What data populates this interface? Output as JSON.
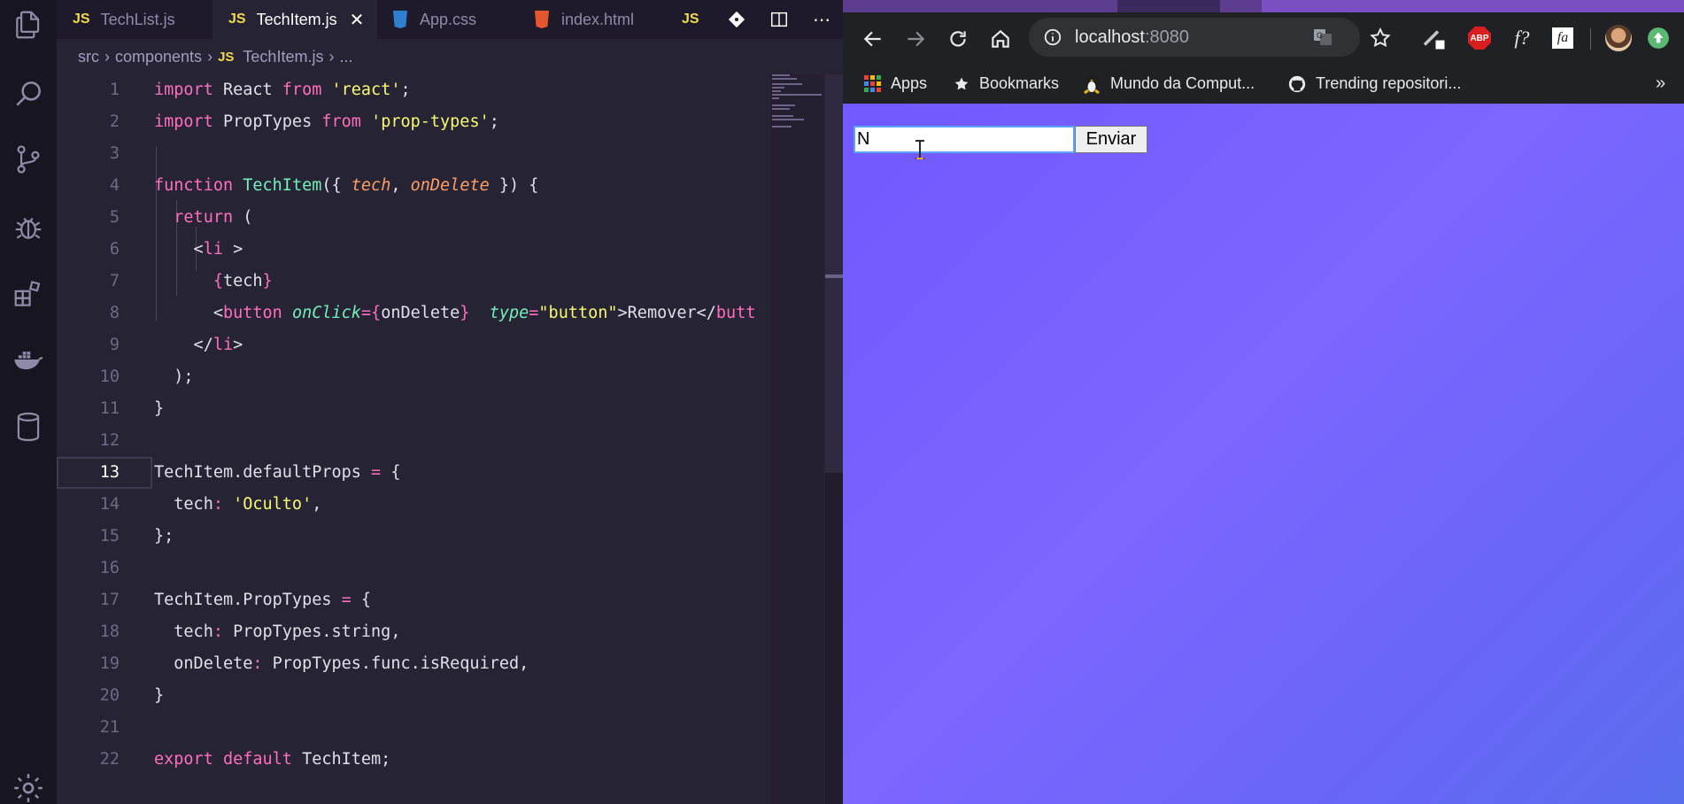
{
  "editor_tabs": [
    {
      "icon": "JS",
      "label": "TechList.js"
    },
    {
      "icon": "JS",
      "label": "TechItem.js",
      "active": true
    },
    {
      "icon": "css3-icon",
      "label": "App.css"
    },
    {
      "icon": "html5-icon",
      "label": "index.html"
    },
    {
      "icon": "JS",
      "label": ""
    }
  ],
  "breadcrumb": {
    "parts": [
      "src",
      "components"
    ],
    "file_icon": "JS",
    "file": "TechItem.js",
    "more": "..."
  },
  "code": {
    "line_numbers": [
      "1",
      "2",
      "3",
      "4",
      "5",
      "6",
      "7",
      "8",
      "9",
      "10",
      "11",
      "12",
      "13",
      "14",
      "15",
      "16",
      "17",
      "18",
      "19",
      "20",
      "21",
      "22"
    ],
    "current_line": "13"
  },
  "browser": {
    "url_host": "localhost",
    "url_port": ":8080",
    "bookmarks": [
      "Apps",
      "Bookmarks",
      "Mundo da Comput...",
      "Trending repositori..."
    ],
    "overflow": "»",
    "extension_labels": {
      "abp": "ABP",
      "fx": "f?",
      "fa": "fa"
    }
  },
  "app": {
    "input_value": "N",
    "submit_label": "Enviar"
  },
  "colors": {
    "accent": "#ff6ebd",
    "editor_bg": "#262335",
    "viewport_gradient": [
      "#7158ff",
      "#5b6ef0"
    ]
  }
}
